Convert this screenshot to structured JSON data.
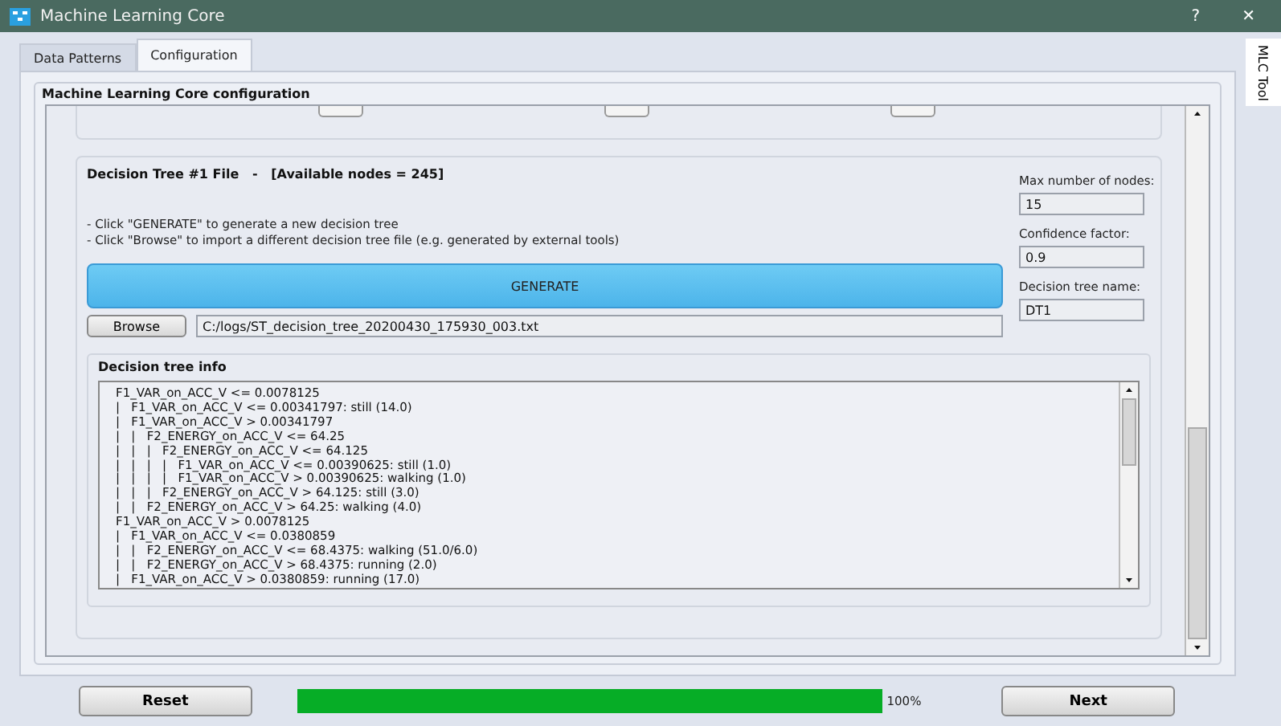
{
  "window": {
    "title": "Machine Learning Core",
    "help": "?",
    "close": "✕"
  },
  "tabs": [
    {
      "label": "Data Patterns",
      "selected": false
    },
    {
      "label": "Configuration",
      "selected": true
    }
  ],
  "side_tab": {
    "label": "MLC Tool"
  },
  "group": {
    "title": "Machine Learning Core configuration"
  },
  "decision_tree": {
    "title": "Decision Tree #1 File   -   [Available nodes = 245]",
    "instructions": [
      "- Click \"GENERATE\" to generate a new decision tree",
      "- Click \"Browse\" to import a different decision tree file (e.g. generated by external tools)"
    ],
    "generate_button": "GENERATE",
    "browse_button": "Browse",
    "file_path": "C:/logs/ST_decision_tree_20200430_175930_003.txt",
    "fields": [
      {
        "label": "Max number of nodes:",
        "value": "15"
      },
      {
        "label": "Confidence factor:",
        "value": "0.9"
      },
      {
        "label": "Decision tree name:",
        "value": "DT1"
      }
    ],
    "info_title": "Decision tree info",
    "info_lines": [
      "F1_VAR_on_ACC_V <= 0.0078125",
      "|   F1_VAR_on_ACC_V <= 0.00341797: still (14.0)",
      "|   F1_VAR_on_ACC_V > 0.00341797",
      "|   |   F2_ENERGY_on_ACC_V <= 64.25",
      "|   |   |   F2_ENERGY_on_ACC_V <= 64.125",
      "|   |   |   |   F1_VAR_on_ACC_V <= 0.00390625: still (1.0)",
      "|   |   |   |   F1_VAR_on_ACC_V > 0.00390625: walking (1.0)",
      "|   |   |   F2_ENERGY_on_ACC_V > 64.125: still (3.0)",
      "|   |   F2_ENERGY_on_ACC_V > 64.25: walking (4.0)",
      "F1_VAR_on_ACC_V > 0.0078125",
      "|   F1_VAR_on_ACC_V <= 0.0380859",
      "|   |   F2_ENERGY_on_ACC_V <= 68.4375: walking (51.0/6.0)",
      "|   |   F2_ENERGY_on_ACC_V > 68.4375: running (2.0)",
      "|   F1_VAR_on_ACC_V > 0.0380859: running (17.0)"
    ]
  },
  "footer": {
    "reset_button": "Reset",
    "progress": {
      "level": 1.0,
      "reading": "100%"
    },
    "next_button": "Next"
  }
}
